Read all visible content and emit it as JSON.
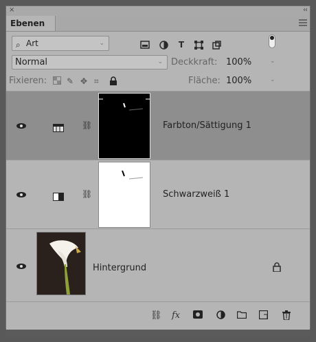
{
  "panel": {
    "close_glyph": "×",
    "collapse_glyph": "‹‹",
    "tab_label": "Ebenen"
  },
  "filter": {
    "kind_label": "Art",
    "icons": [
      "image-filter-icon",
      "adjustment-filter-icon",
      "type-filter-icon",
      "shape-filter-icon",
      "smart-object-filter-icon"
    ]
  },
  "blend": {
    "mode": "Normal",
    "opacity_label": "Deckkraft:",
    "opacity_value": "100%"
  },
  "locks": {
    "label": "Fixieren:",
    "fill_label": "Fläche:",
    "fill_value": "100%"
  },
  "layers": [
    {
      "name": "Farbton/Sättigung 1",
      "type": "hue-saturation",
      "selected": true
    },
    {
      "name": "Schwarzweiß 1",
      "type": "black-white",
      "selected": false
    },
    {
      "name": "Hintergrund",
      "type": "background",
      "locked": true
    }
  ],
  "footer_icons": [
    "link-layers-icon",
    "fx-icon",
    "add-mask-icon",
    "new-adjustment-icon",
    "new-group-icon",
    "new-layer-icon",
    "trash-icon"
  ],
  "footer_fx_label": "fx"
}
